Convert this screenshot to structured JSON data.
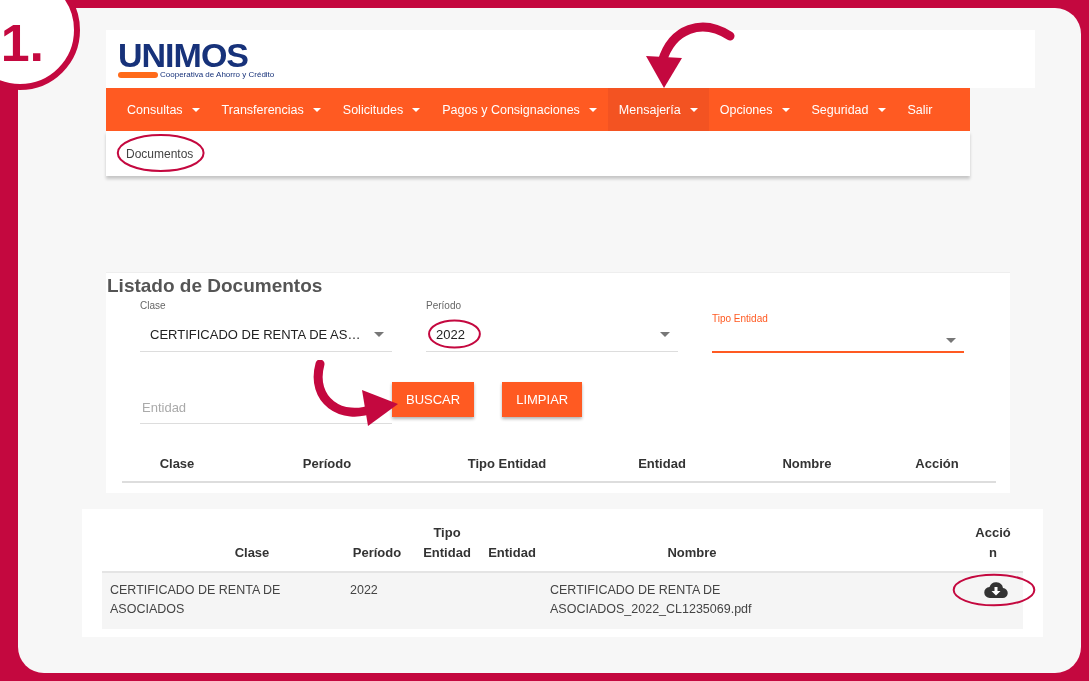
{
  "step_badge": "1.",
  "logo": {
    "name": "UNIMOS",
    "tagline": "Cooperativa de Ahorro y Crédito"
  },
  "nav": [
    {
      "label": "Consultas",
      "has_dropdown": true,
      "selected": false
    },
    {
      "label": "Transferencias",
      "has_dropdown": true,
      "selected": false
    },
    {
      "label": "Solicitudes",
      "has_dropdown": true,
      "selected": false
    },
    {
      "label": "Pagos y Consignaciones",
      "has_dropdown": true,
      "selected": false
    },
    {
      "label": "Mensajería",
      "has_dropdown": true,
      "selected": true,
      "pointed": true
    },
    {
      "label": "Opciones",
      "has_dropdown": true,
      "selected": false
    },
    {
      "label": "Seguridad",
      "has_dropdown": true,
      "selected": false
    },
    {
      "label": "Salir",
      "has_dropdown": false,
      "selected": false
    }
  ],
  "submenu": [
    {
      "label": "Documentos",
      "highlighted": true
    }
  ],
  "filters": {
    "title": "Listado de Documentos",
    "fields": [
      {
        "label": "Clase",
        "value": "CERTIFICADO DE RENTA DE AS…",
        "focused": false
      },
      {
        "label": "Período",
        "value": "2022",
        "focused": false,
        "highlighted": true
      },
      {
        "label": "Tipo Entidad",
        "focused": true
      },
      {
        "placeholder": "Entidad",
        "focused": false
      }
    ],
    "buttons": [
      {
        "label": "BUSCAR",
        "pointed": true
      },
      {
        "label": "LIMPIAR"
      }
    ],
    "columns": [
      "Clase",
      "Período",
      "Tipo Entidad",
      "Entidad",
      "Nombre",
      "Acción"
    ]
  },
  "results": {
    "columns": [
      "Clase",
      "Período",
      "Tipo Entidad",
      "Entidad",
      "Nombre",
      "Acción"
    ],
    "rows": [
      {
        "clase": "CERTIFICADO DE RENTA DE ASOCIADOS",
        "periodo": "2022",
        "nombre": "CERTIFICADO DE RENTA DE ASOCIADOS_2022_CL1235069.pdf",
        "action_highlighted": true
      }
    ]
  }
}
